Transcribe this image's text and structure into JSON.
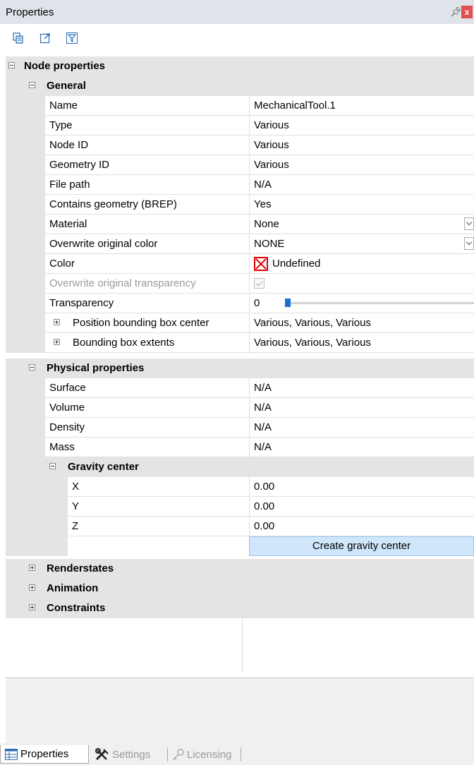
{
  "window": {
    "title": "Properties",
    "pin_glyph": "ᵖ",
    "close_glyph": "x"
  },
  "toolbar": {
    "icons": [
      "copy-icon",
      "export-icon",
      "filter-icon"
    ]
  },
  "tree": {
    "node_properties": "Node properties",
    "general": {
      "label": "General",
      "rows": [
        {
          "name": "Name",
          "value": "MechanicalTool.1"
        },
        {
          "name": "Type",
          "value": "Various"
        },
        {
          "name": "Node ID",
          "value": "Various"
        },
        {
          "name": "Geometry ID",
          "value": "Various"
        },
        {
          "name": "File path",
          "value": "N/A"
        },
        {
          "name": "Contains geometry (BREP)",
          "value": "Yes"
        },
        {
          "name": "Material",
          "value": "None"
        },
        {
          "name": "Overwrite original color",
          "value": "NONE"
        },
        {
          "name": "Color",
          "value": "Undefined"
        },
        {
          "name": "Overwrite original transparency",
          "checked": true
        },
        {
          "name": "Transparency",
          "value": "0"
        },
        {
          "name": "Position bounding box center",
          "value": "Various, Various, Various"
        },
        {
          "name": "Bounding box extents",
          "value": "Various, Various, Various"
        }
      ]
    },
    "physical": {
      "label": "Physical properties",
      "rows": [
        {
          "name": "Surface",
          "value": "N/A"
        },
        {
          "name": "Volume",
          "value": "N/A"
        },
        {
          "name": "Density",
          "value": "N/A"
        },
        {
          "name": "Mass",
          "value": "N/A"
        }
      ],
      "gravity_center": {
        "label": "Gravity center",
        "rows": [
          {
            "name": "X",
            "value": "0.00"
          },
          {
            "name": "Y",
            "value": "0.00"
          },
          {
            "name": "Z",
            "value": "0.00"
          }
        ],
        "button": "Create gravity center"
      }
    },
    "renderstates": "Renderstates",
    "animation": "Animation",
    "constraints": "Constraints"
  },
  "tabs": [
    {
      "label": "Properties",
      "active": true
    },
    {
      "label": "Settings",
      "active": false
    },
    {
      "label": "Licensing",
      "active": false
    }
  ],
  "colors": {
    "accent": "#1e6fd0",
    "category_bg": "#e4e4e4",
    "button_bg": "#cfe6fb"
  }
}
